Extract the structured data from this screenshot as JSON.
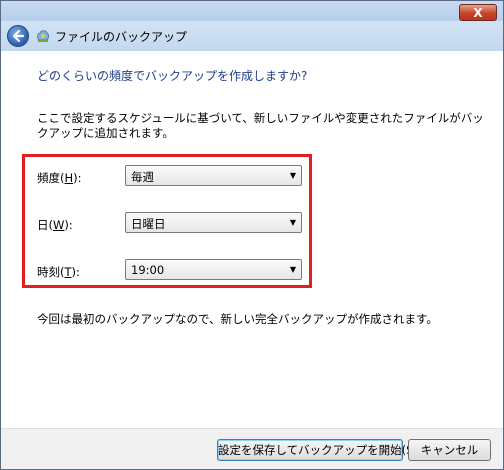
{
  "window": {
    "close_label": "X"
  },
  "header": {
    "title": "ファイルのバックアップ"
  },
  "main": {
    "instruction": "どのくらいの頻度でバックアップを作成しますか?",
    "description": "ここで設定するスケジュールに基づいて、新しいファイルや変更されたファイルがバックアップに追加されます。",
    "fields": [
      {
        "label_prefix": "頻度(",
        "access_key": "H",
        "label_suffix": "):",
        "value": "毎週"
      },
      {
        "label_prefix": "日(",
        "access_key": "W",
        "label_suffix": "):",
        "value": "日曜日"
      },
      {
        "label_prefix": "時刻(",
        "access_key": "T",
        "label_suffix": "):",
        "value": "19:00"
      }
    ],
    "note": "今回は最初のバックアップなので、新しい完全バックアップが作成されます。"
  },
  "footer": {
    "save_label": "設定を保存してバックアップを開始(S)",
    "cancel_label": "キャンセル"
  },
  "colors": {
    "instruction_text": "#1f3d8a",
    "highlight_border": "#e21e1e",
    "close_button": "#c8442c"
  },
  "icons": {
    "back": "back-arrow-icon",
    "app": "backup-app-icon",
    "dropdown": "chevron-down-icon",
    "close": "close-icon"
  }
}
